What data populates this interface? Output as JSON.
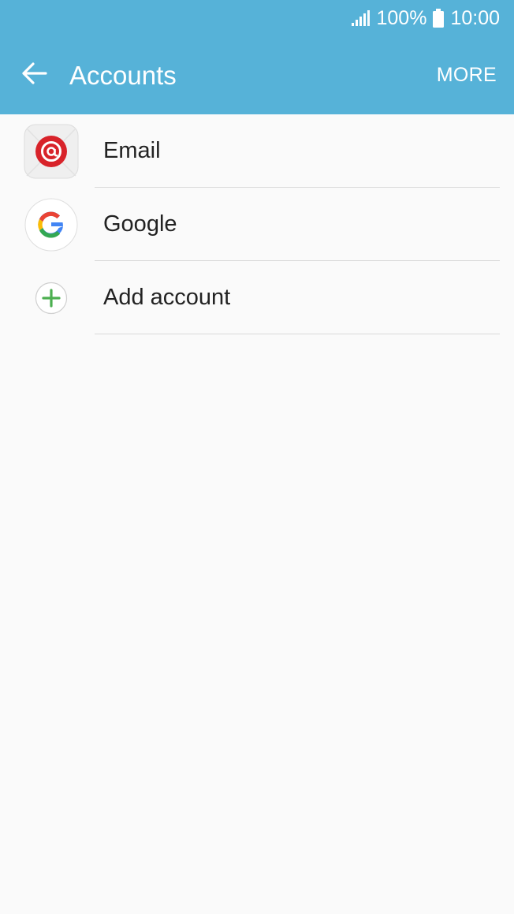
{
  "status_bar": {
    "battery_percent": "100%",
    "time": "10:00",
    "signal_icon": "signal-icon",
    "battery_icon": "battery-icon"
  },
  "app_bar": {
    "title": "Accounts",
    "more_label": "MORE",
    "back_icon": "back-arrow-icon"
  },
  "accounts": [
    {
      "label": "Email",
      "icon": "email-app-icon"
    },
    {
      "label": "Google",
      "icon": "google-icon"
    },
    {
      "label": "Add account",
      "icon": "add-icon"
    }
  ],
  "colors": {
    "accent": "#56b2d8",
    "background": "#fafafa",
    "text": "#222222",
    "divider": "#d9d9d9",
    "add_green": "#4caf50",
    "email_red": "#d8232a"
  }
}
